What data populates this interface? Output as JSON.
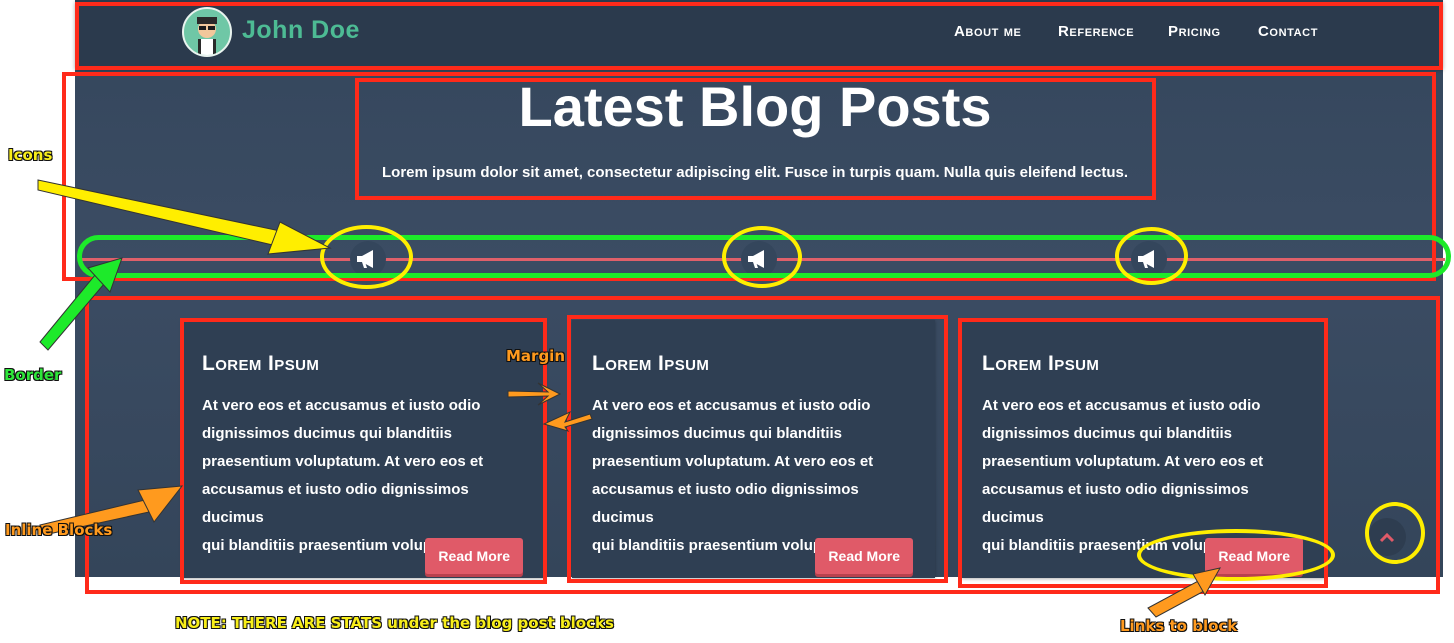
{
  "header": {
    "brand": "John Doe",
    "nav": [
      "About me",
      "Reference",
      "Pricing",
      "Contact"
    ]
  },
  "hero": {
    "title": "Latest Blog Posts",
    "subtitle": "Lorem ipsum dolor sit amet, consectetur adipiscing elit. Fusce in turpis quam. Nulla quis eleifend lectus."
  },
  "divider": {
    "icon": "megaphone-icon",
    "color": "#e0606a"
  },
  "cards": [
    {
      "title": "Lorem Ipsum",
      "lines": [
        "At vero eos et accusamus et iusto odio",
        "dignissimos ducimus qui blanditiis",
        "praesentium voluptatum. At vero eos et",
        "accusamus et iusto odio dignissimos ducimus",
        "qui blanditiis praesentium voluptatum"
      ],
      "button": "Read More"
    },
    {
      "title": "Lorem Ipsum",
      "lines": [
        "At vero eos et accusamus et iusto odio",
        "dignissimos ducimus qui blanditiis",
        "praesentium voluptatum. At vero eos et",
        "accusamus et iusto odio dignissimos ducimus",
        "qui blanditiis praesentium voluptatum"
      ],
      "button": "Read More"
    },
    {
      "title": "Lorem Ipsum",
      "lines": [
        "At vero eos et accusamus et iusto odio",
        "dignissimos ducimus qui blanditiis",
        "praesentium voluptatum. At vero eos et",
        "accusamus et iusto odio dignissimos ducimus",
        "qui blanditiis praesentium voluptatum"
      ],
      "button": "Read More"
    }
  ],
  "back_to_top": {
    "icon": "chevron-up-icon"
  },
  "annotations": {
    "icons": "Icons",
    "border": "Border",
    "inline_blocks": "Inline Blocks",
    "margin": "Margin",
    "note": "NOTE: THERE ARE STATS under the blog post blocks",
    "links": "Links to block"
  },
  "colors": {
    "brand": "#4dbb94",
    "accent": "#e05a68",
    "background": "#3a4b62",
    "annotation_red": "#ff2a1a",
    "annotation_green": "#1dea2a",
    "annotation_yellow": "#ffee00",
    "annotation_orange": "#ff9a1e"
  }
}
